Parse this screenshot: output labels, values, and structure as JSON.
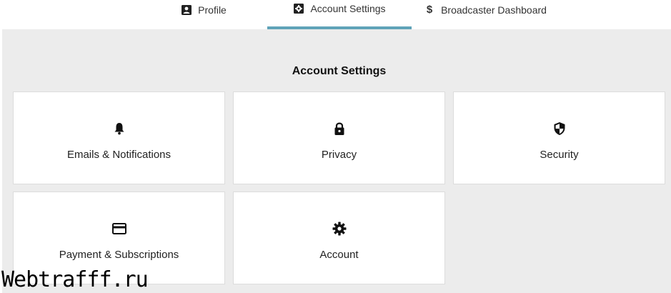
{
  "tabs": [
    {
      "label": "Profile",
      "icon": "profile-icon"
    },
    {
      "label": "Account Settings",
      "icon": "account-settings-icon",
      "active": true
    },
    {
      "label": "Broadcaster Dashboard",
      "icon": "dollar-icon"
    }
  ],
  "active_tab_color": "#5fa3b8",
  "panel": {
    "title": "Account Settings",
    "cards": [
      {
        "label": "Emails & Notifications",
        "icon": "bell-icon"
      },
      {
        "label": "Privacy",
        "icon": "lock-icon"
      },
      {
        "label": "Security",
        "icon": "shield-icon"
      },
      {
        "label": "Payment & Subscriptions",
        "icon": "credit-card-icon"
      },
      {
        "label": "Account",
        "icon": "gear-icon"
      }
    ]
  },
  "watermark": "Webtrafff.ru"
}
